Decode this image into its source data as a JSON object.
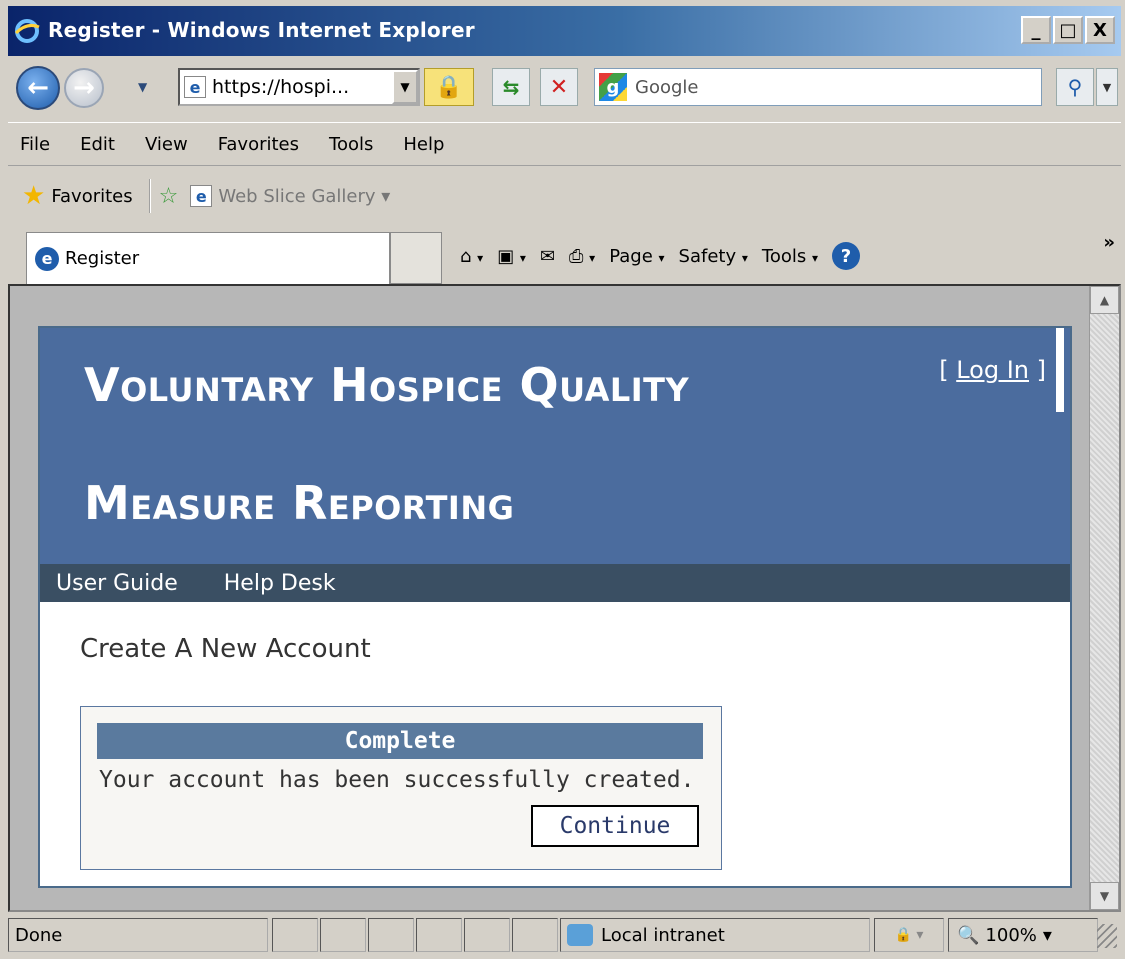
{
  "window": {
    "title": "Register - Windows Internet Explorer",
    "minimize": "_",
    "maximize": "□",
    "close": "X"
  },
  "toolbar": {
    "address": "https://hospi...",
    "search_placeholder": "Google"
  },
  "menu": [
    "File",
    "Edit",
    "View",
    "Favorites",
    "Tools",
    "Help"
  ],
  "favorites_bar": {
    "favorites_label": "Favorites",
    "web_slice_label": "Web Slice Gallery"
  },
  "tab": {
    "label": "Register"
  },
  "command_bar": {
    "page_label": "Page",
    "safety_label": "Safety",
    "tools_label": "Tools"
  },
  "site": {
    "title_line1": "Voluntary Hospice Quality",
    "title_line2": "Measure Reporting",
    "login_open": "[ ",
    "login_link": "Log In",
    "login_close": " ]",
    "nav": [
      "User Guide",
      "Help Desk"
    ],
    "heading": "Create A New Account",
    "box_title": "Complete",
    "box_message": "Your account has been successfully created.",
    "continue_label": "Continue"
  },
  "status_bar": {
    "status_text": "Done",
    "zone": "Local intranet",
    "zoom": "100%"
  }
}
